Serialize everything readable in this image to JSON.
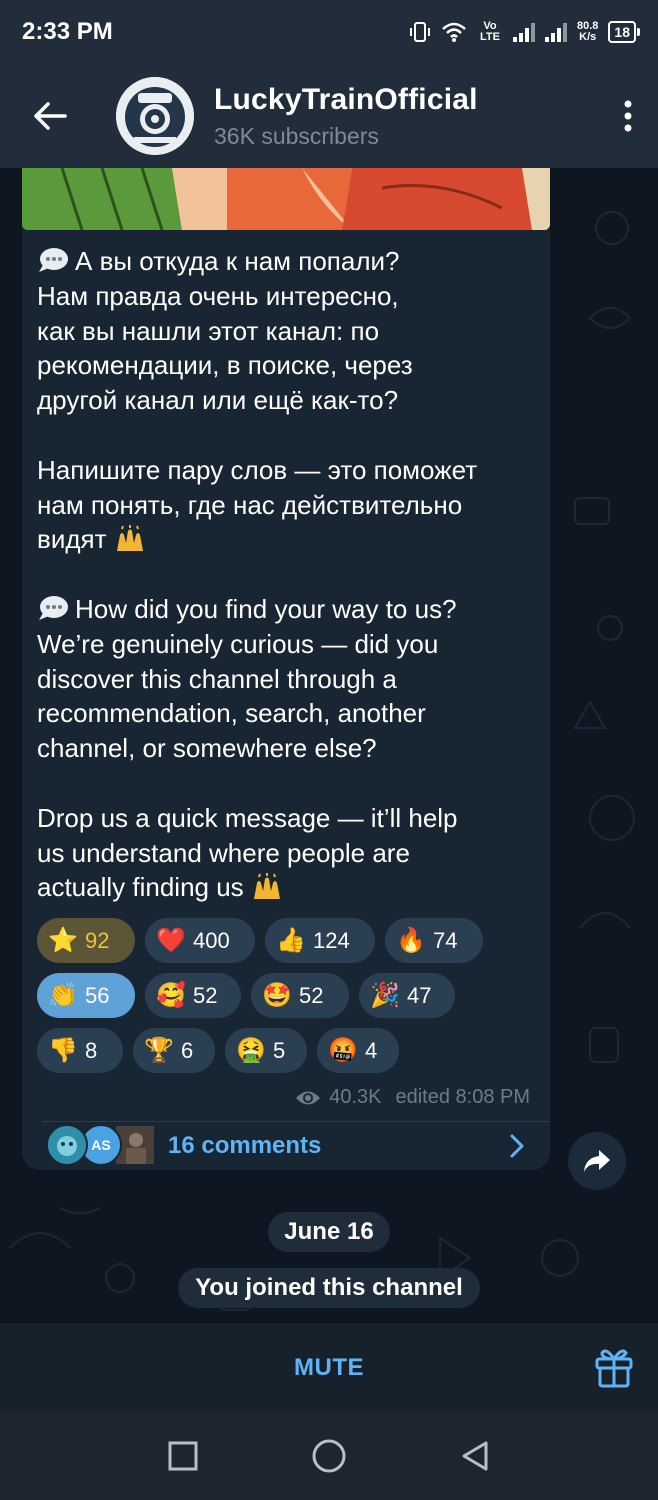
{
  "status_bar": {
    "time": "2:33 PM",
    "network": "Vo LTE",
    "speed_value": "80.8",
    "speed_unit": "K/s",
    "battery": "18"
  },
  "header": {
    "title": "LuckyTrainOfficial",
    "subtitle": "36K subscribers",
    "back_icon": "arrow-left-icon",
    "menu_icon": "more-vertical-icon"
  },
  "post": {
    "paragraphs": [
      "А вы откуда к нам попали?\nНам правда очень интересно,\nкак вы нашли этот канал: по\nрекомендации, в поиске, через\nдругой канал или ещё как-то?",
      "Напишите пару слов — это поможет\nнам понять, где нас действительно\nвидят",
      "How did you find your way to us?\nWe’re genuinely curious — did you\ndiscover this channel through a\nrecommendation, search, another\nchannel, or somewhere else?",
      "Drop us a quick message — it’ll help\nus understand where people are\nactually finding us"
    ],
    "reactions": [
      {
        "emoji": "⭐",
        "count": "92",
        "state": "gold"
      },
      {
        "emoji": "❤️",
        "count": "400",
        "state": ""
      },
      {
        "emoji": "👍",
        "count": "124",
        "state": ""
      },
      {
        "emoji": "🔥",
        "count": "74",
        "state": ""
      },
      {
        "emoji": "👏",
        "count": "56",
        "state": "blue"
      },
      {
        "emoji": "🥰",
        "count": "52",
        "state": ""
      },
      {
        "emoji": "🤩",
        "count": "52",
        "state": ""
      },
      {
        "emoji": "🎉",
        "count": "47",
        "state": ""
      },
      {
        "emoji": "👎",
        "count": "8",
        "state": ""
      },
      {
        "emoji": "🏆",
        "count": "6",
        "state": ""
      },
      {
        "emoji": "🤮",
        "count": "5",
        "state": ""
      },
      {
        "emoji": "🤬",
        "count": "4",
        "state": ""
      }
    ],
    "views": "40.3K",
    "edited": "edited 8:08 PM",
    "comments_label": "16 comments",
    "commenter_initials": "AS"
  },
  "service": {
    "date": "June 16",
    "joined": "You joined this channel"
  },
  "bottom": {
    "mute_label": "MUTE"
  },
  "colors": {
    "accent": "#5fb4f6",
    "bubble": "#182533",
    "header": "#212d3b",
    "chat_bg": "#0e1621"
  }
}
